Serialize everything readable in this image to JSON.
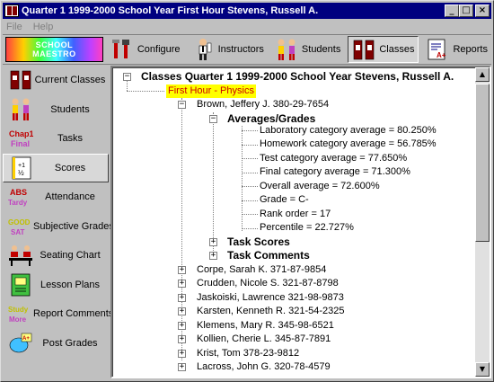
{
  "window": {
    "title": "Quarter 1  1999-2000 School Year  First Hour  Stevens, Russell A.",
    "controls": {
      "minimize": "_",
      "maximize": "□",
      "close": "×"
    }
  },
  "menu": {
    "file": "File",
    "help": "Help"
  },
  "toolbar": {
    "logo_line1": "SCHOOL",
    "logo_line2": "MAESTRO",
    "items": [
      {
        "label": "Configure",
        "icon": "tools-icon"
      },
      {
        "label": "Instructors",
        "icon": "instructor-icon"
      },
      {
        "label": "Students",
        "icon": "students-icon"
      },
      {
        "label": "Classes",
        "icon": "classes-icon",
        "active": true
      },
      {
        "label": "Reports",
        "icon": "report-icon"
      }
    ]
  },
  "sidebar": {
    "items": [
      {
        "label": "Current Classes",
        "icon": "doors-icon"
      },
      {
        "label": "Students",
        "icon": "students-icon"
      },
      {
        "label": "Tasks",
        "icon": "chap-final-icon",
        "icon_text1": "Chap1",
        "icon_text2": "Final"
      },
      {
        "label": "Scores",
        "icon": "scores-icon",
        "active": true
      },
      {
        "label": "Attendance",
        "icon": "abs-tardy-icon",
        "icon_text1": "ABS",
        "icon_text2": "Tardy"
      },
      {
        "label": "Subjective Grades",
        "icon": "good-sat-icon",
        "icon_text1": "GOOD",
        "icon_text2": "SAT"
      },
      {
        "label": "Seating Chart",
        "icon": "seating-icon"
      },
      {
        "label": "Lesson Plans",
        "icon": "lesson-icon"
      },
      {
        "label": "Report Comments",
        "icon": "study-more-icon",
        "icon_text1": "Study",
        "icon_text2": "More"
      },
      {
        "label": "Post Grades",
        "icon": "post-grades-icon"
      }
    ]
  },
  "tree": {
    "root": "Classes Quarter 1  1999-2000 School Year Stevens, Russell A.",
    "class_node": "First Hour - Physics",
    "expanded_student": "Brown, Jeffery J. 380-29-7654",
    "averages_header": "Averages/Grades",
    "averages": [
      "Laboratory category average = 80.250%",
      "Homework category average = 56.785%",
      "Test category average = 77.650%",
      "Final category average = 71.300%",
      "Overall average = 72.600%",
      "Grade = C-",
      "Rank order = 17",
      "Percentile = 22.727%"
    ],
    "task_scores": "Task Scores",
    "task_comments": "Task Comments",
    "students": [
      "Corpe, Sarah K. 371-87-9854",
      "Crudden, Nicole S. 321-87-8798",
      "Jaskoiski, Lawrence 321-98-9873",
      "Karsten, Kenneth R. 321-54-2325",
      "Klemens, Mary R. 345-98-6521",
      "Kollien, Cherie L. 345-87-7891",
      "Krist, Tom 378-23-9812",
      "Lacross, John G. 320-78-4579"
    ]
  },
  "colors": {
    "title_bar": "#000080",
    "highlight": "#ffff00",
    "highlight_text": "#cc0000"
  }
}
